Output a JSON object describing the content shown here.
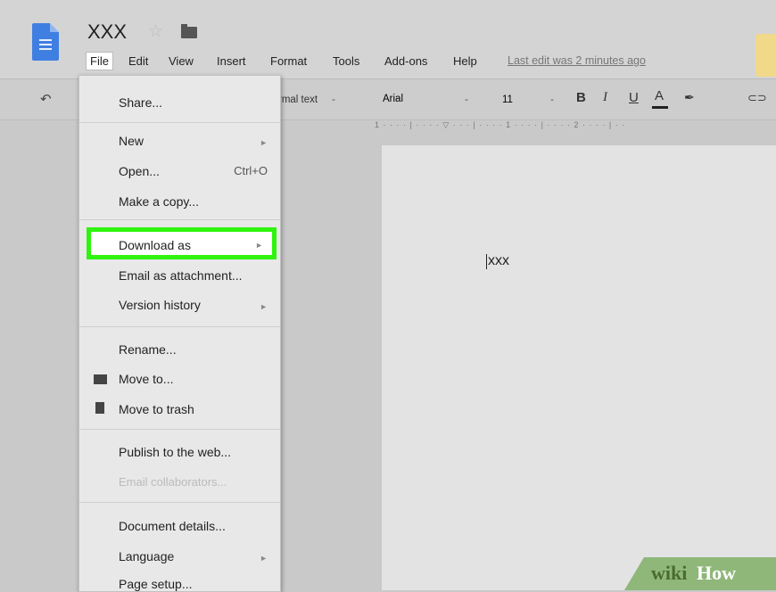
{
  "header": {
    "doc_title": "XXX",
    "last_edit": "Last edit was 2 minutes ago",
    "menu": [
      "File",
      "Edit",
      "View",
      "Insert",
      "Format",
      "Tools",
      "Add-ons",
      "Help"
    ]
  },
  "toolbar": {
    "style": "rmal text",
    "font": "Arial",
    "size": "11",
    "bold": "B",
    "italic": "I",
    "underline": "U",
    "text_color": "A",
    "ruler": "1 · · · · | · · · · ▽ · · · | · · · · 1 · · · · | · · · · 2 · · · · | · ·"
  },
  "document": {
    "text": "xxx"
  },
  "file_menu": {
    "share": "Share...",
    "new": "New",
    "open": "Open...",
    "open_shortcut": "Ctrl+O",
    "make_copy": "Make a copy...",
    "download_as": "Download as",
    "email_attachment": "Email as attachment...",
    "version_history": "Version history",
    "rename": "Rename...",
    "move_to": "Move to...",
    "move_trash": "Move to trash",
    "publish_web": "Publish to the web...",
    "email_collaborators": "Email collaborators...",
    "document_details": "Document details...",
    "language": "Language",
    "page_setup": "Page setup..."
  },
  "watermark": {
    "wiki": "wiki",
    "how": "How"
  },
  "colors": {
    "highlight_border": "#2ef40e",
    "doc_icon": "#3f7fe1"
  }
}
